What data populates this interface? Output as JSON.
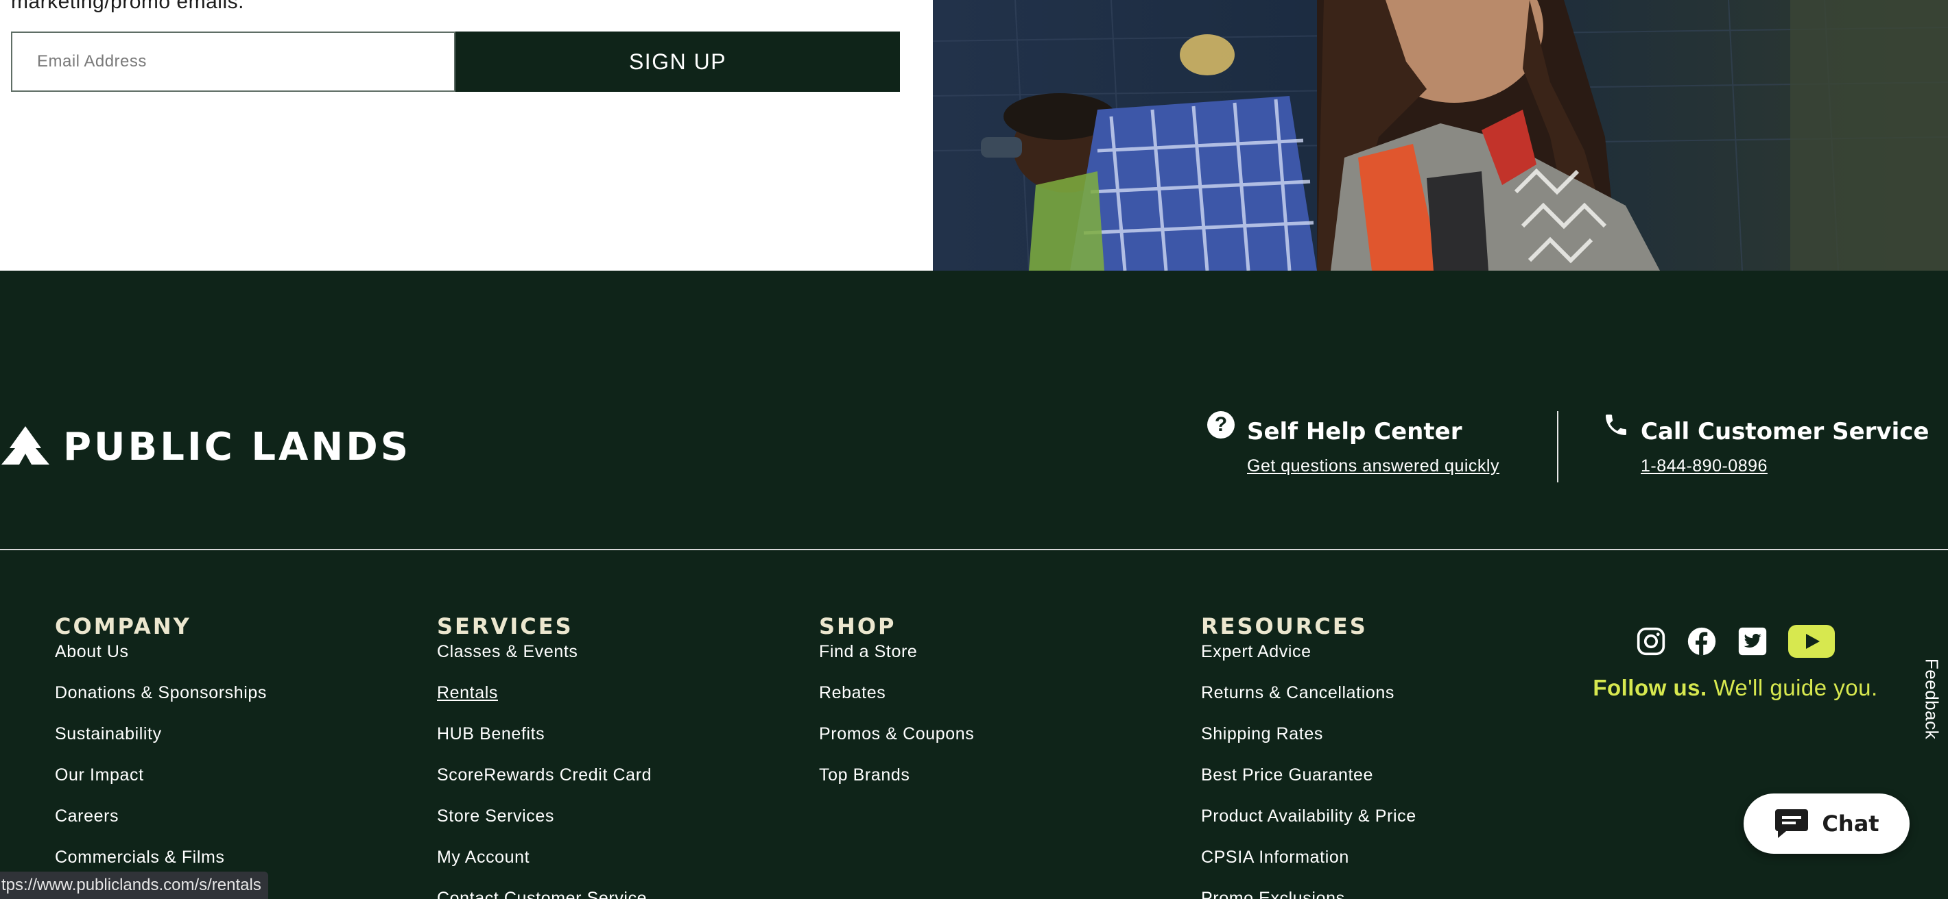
{
  "signup": {
    "text": "marketing/promo emails.",
    "email_placeholder": "Email Address",
    "button_label": "SIGN UP"
  },
  "brand": {
    "logo_text": "PUBLIC LANDS"
  },
  "support": {
    "help_title": "Self Help Center",
    "help_link": "Get questions answered quickly",
    "call_title": "Call Customer Service",
    "call_phone": "1-844-890-0896"
  },
  "footer": {
    "company": {
      "heading": "COMPANY",
      "links": [
        "About Us",
        "Donations & Sponsorships",
        "Sustainability",
        "Our Impact",
        "Careers",
        "Commercials & Films"
      ]
    },
    "services": {
      "heading": "SERVICES",
      "links": [
        "Classes & Events",
        "Rentals",
        "HUB Benefits",
        "ScoreRewards Credit Card",
        "Store Services",
        "My Account",
        "Contact Customer Service"
      ]
    },
    "shop": {
      "heading": "SHOP",
      "links": [
        "Find a Store",
        "Rebates",
        "Promos & Coupons",
        "Top Brands"
      ]
    },
    "resources": {
      "heading": "RESOURCES",
      "links": [
        "Expert Advice",
        "Returns & Cancellations",
        "Shipping Rates",
        "Best Price Guarantee",
        "Product Availability & Price",
        "CPSIA Information",
        "Promo Exclusions"
      ]
    }
  },
  "social": {
    "icons": [
      "instagram-icon",
      "facebook-icon",
      "twitter-icon",
      "youtube-icon"
    ],
    "follow_bold": "Follow us.",
    "follow_text": "We'll guide you."
  },
  "feedback_label": "Feedback",
  "chat_label": "Chat",
  "status_url": "tps://www.publiclands.com/s/rentals",
  "colors": {
    "footer_bg": "#0f2419",
    "heading": "#ece7cf",
    "accent_yellow": "#d7e84f",
    "white": "#ffffff"
  }
}
